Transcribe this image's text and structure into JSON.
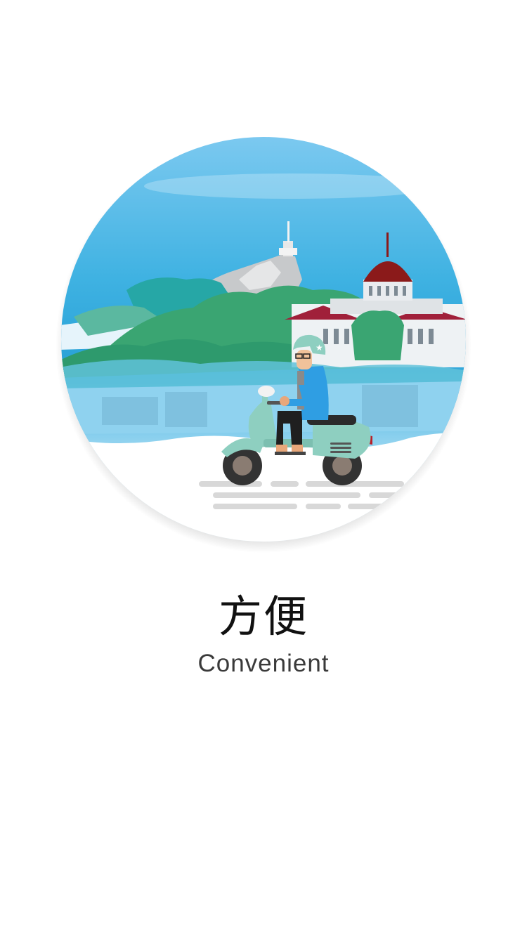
{
  "onboarding": {
    "title": "方便",
    "subtitle": "Convenient"
  },
  "illustration": {
    "subject": "rider-on-scooter-city-scene",
    "colors": {
      "sky_top": "#7cc9f0",
      "sky_bottom": "#2aa3d8",
      "hill_green": "#3aa572",
      "dome_red": "#8b1a1a",
      "scooter": "#8ecfc0",
      "jacket": "#2f9ee3",
      "road": "#d8d8d8"
    }
  }
}
